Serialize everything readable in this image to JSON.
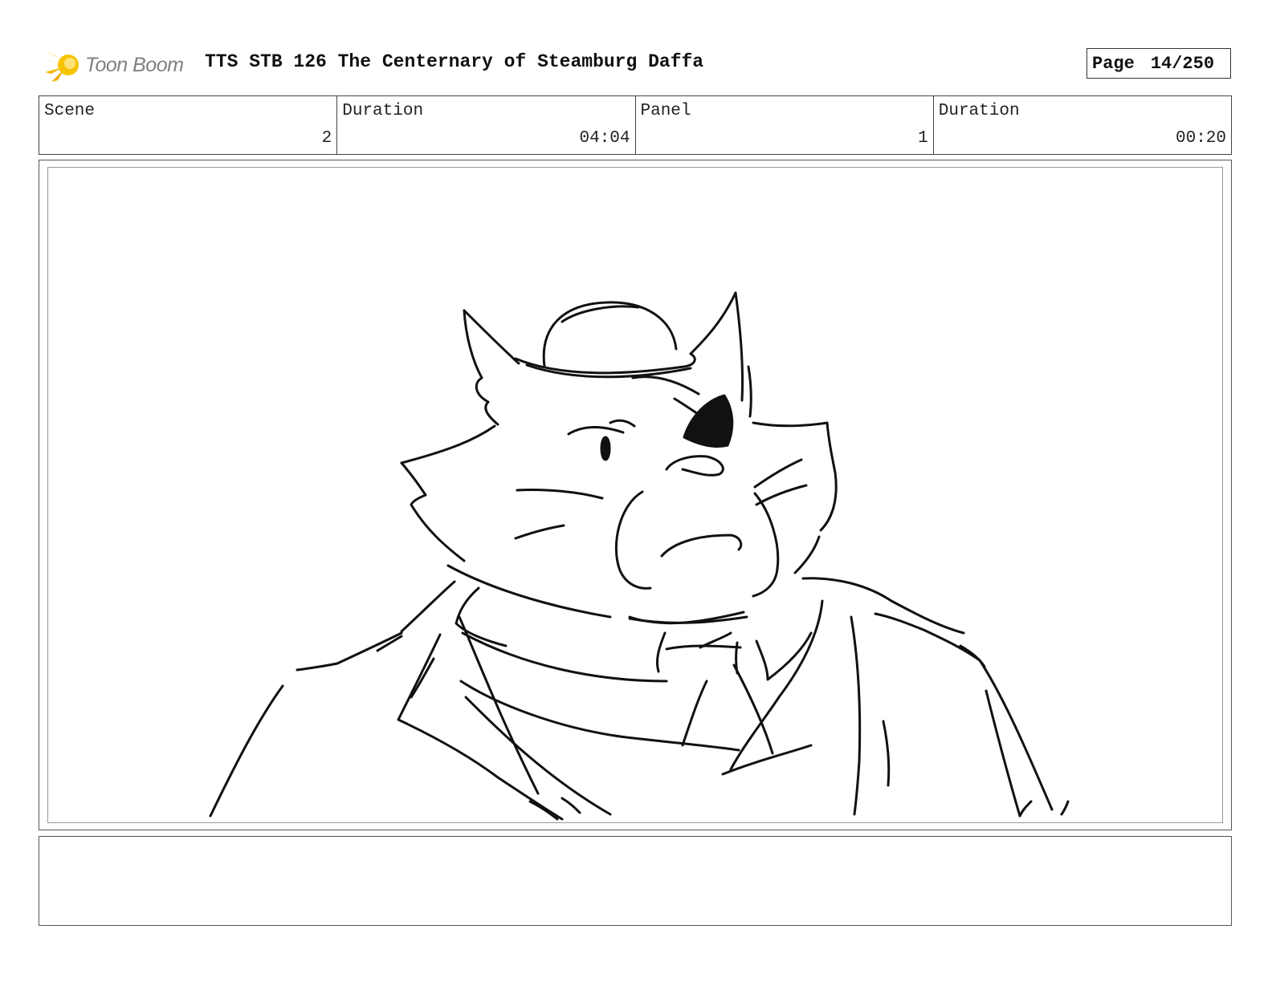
{
  "header": {
    "logo_text": "Toon Boom",
    "title": "TTS STB 126 The Centernary of Steamburg Daffa",
    "page_label": "Page",
    "page_value": "14/250"
  },
  "info": {
    "scene_label": "Scene",
    "scene_value": "2",
    "scene_duration_label": "Duration",
    "scene_duration_value": "04:04",
    "panel_label": "Panel",
    "panel_value": "1",
    "panel_duration_label": "Duration",
    "panel_duration_value": "00:20"
  },
  "notes": {
    "text": ""
  },
  "colors": {
    "logo_star": "#f5b800",
    "logo_text": "#808080",
    "border": "#444444"
  },
  "icons": {
    "logo": "toon-boom-star-icon"
  }
}
